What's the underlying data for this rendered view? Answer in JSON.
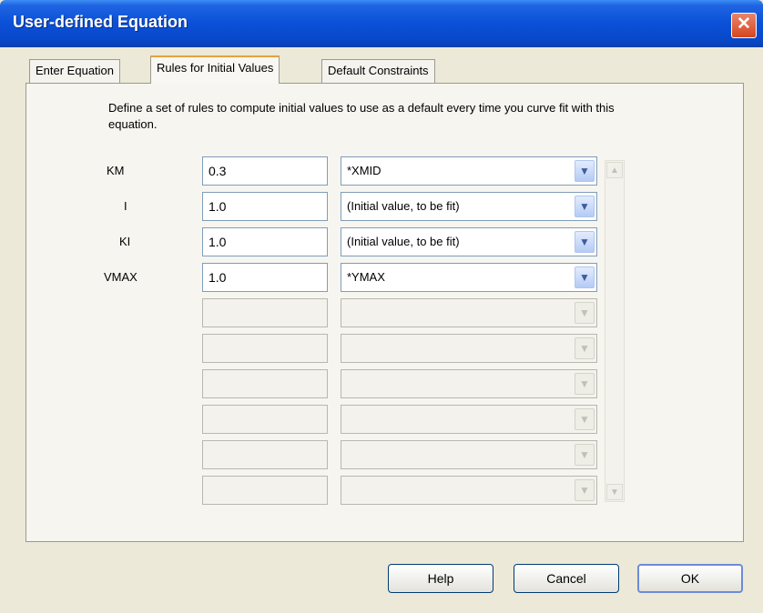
{
  "window": {
    "title": "User-defined Equation",
    "close_glyph": "✕"
  },
  "tabs": [
    {
      "label": "Enter Equation"
    },
    {
      "label": "Rules for Initial Values"
    },
    {
      "label": "Default Constraints"
    }
  ],
  "description": "Define a set of rules to compute initial values to use as a default every time you curve fit with this equation.",
  "params": [
    {
      "name": "KM",
      "value": "0.3",
      "rule": "*XMID"
    },
    {
      "name": "I",
      "value": "1.0",
      "rule": "(Initial value, to be fit)"
    },
    {
      "name": "KI",
      "value": "1.0",
      "rule": "(Initial value, to be fit)"
    },
    {
      "name": "VMAX",
      "value": "1.0",
      "rule": "*YMAX"
    }
  ],
  "buttons": {
    "help": "Help",
    "cancel": "Cancel",
    "ok": "OK"
  },
  "icons": {
    "dropdown": "chevron-down-icon",
    "scroll_up": "scroll-up-icon",
    "scroll_down": "scroll-down-icon"
  }
}
